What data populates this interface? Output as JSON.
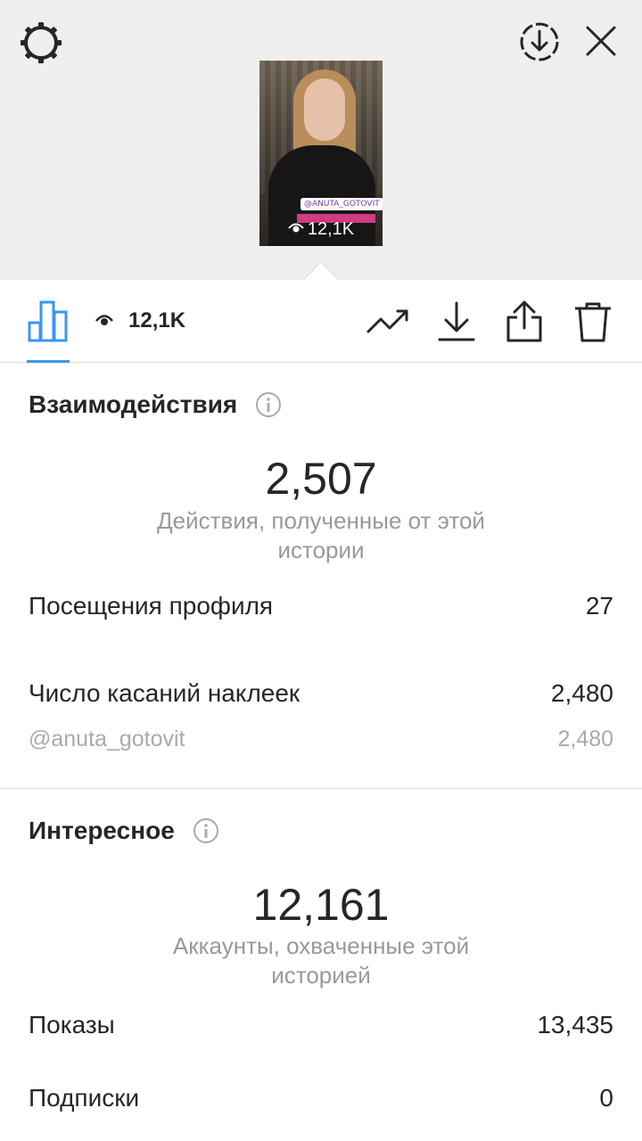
{
  "header": {
    "icons": [
      "gear-icon",
      "download-circle-icon",
      "close-icon"
    ]
  },
  "thumbnail": {
    "sticker_text": "@ANUTA_GOTOVIT",
    "views": "12,1K"
  },
  "tabbar": {
    "views": "12,1K",
    "accent_color": "#3897f0",
    "icons": [
      "bar-chart-icon",
      "eye-icon",
      "trend-icon",
      "download-icon",
      "share-icon",
      "trash-icon"
    ]
  },
  "interactions": {
    "title": "Взаимодействия",
    "total": "2,507",
    "caption": "Действия, полученные от этой истории",
    "rows": [
      {
        "label": "Посещения профиля",
        "value": "27"
      },
      {
        "label": "Число касаний наклеек",
        "value": "2,480"
      }
    ],
    "sub_row": {
      "label": "@anuta_gotovit",
      "value": "2,480"
    }
  },
  "discovery": {
    "title": "Интересное",
    "total": "12,161",
    "caption": "Аккаунты, охваченные этой историей",
    "rows": [
      {
        "label": "Показы",
        "value": "13,435"
      },
      {
        "label": "Подписки",
        "value": "0"
      }
    ]
  }
}
